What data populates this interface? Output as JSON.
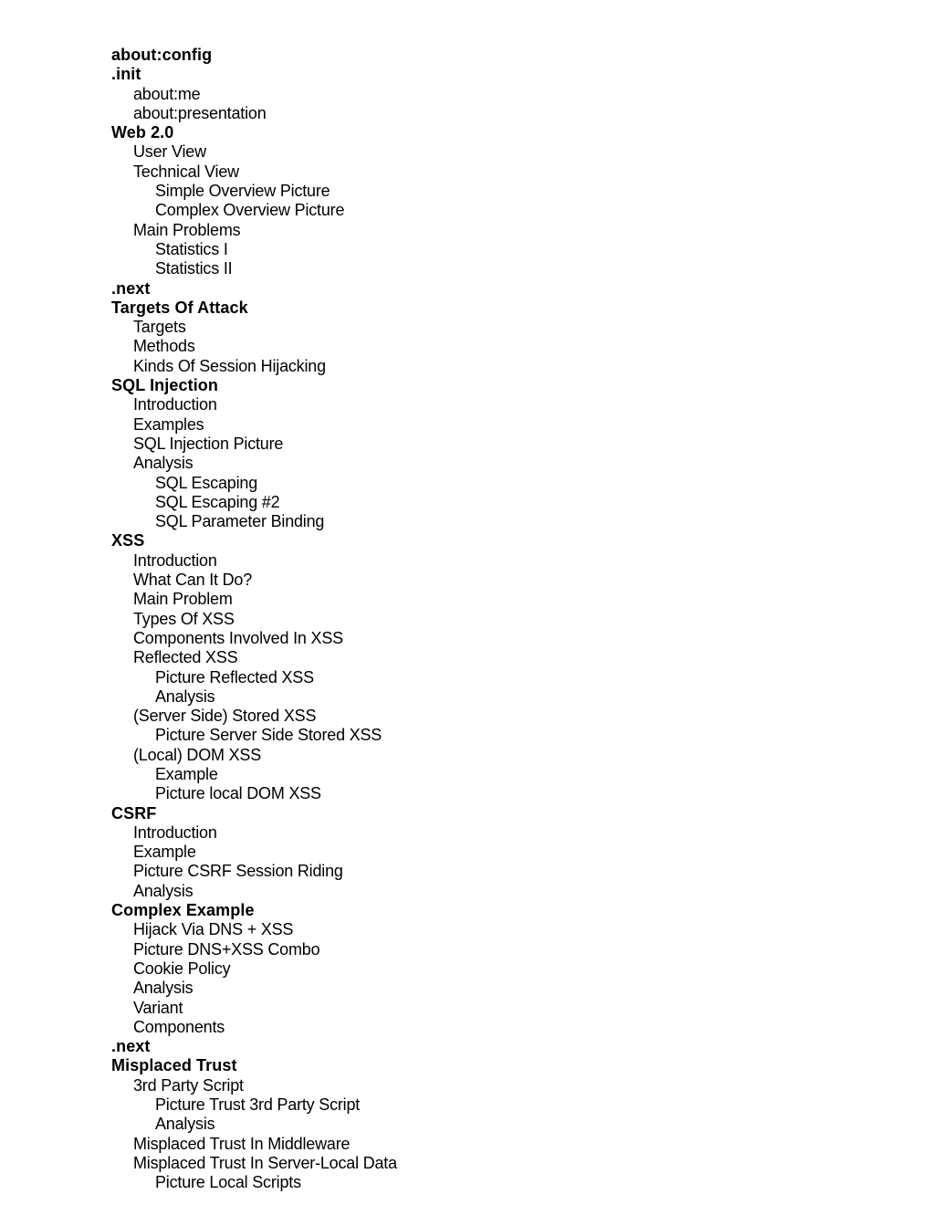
{
  "outline": [
    {
      "label": "about:config",
      "level": 0
    },
    {
      "label": ".init",
      "level": 0
    },
    {
      "label": "about:me",
      "level": 1
    },
    {
      "label": "about:presentation",
      "level": 1
    },
    {
      "label": "Web 2.0",
      "level": 0
    },
    {
      "label": "User View",
      "level": 1
    },
    {
      "label": "Technical View",
      "level": 1
    },
    {
      "label": "Simple Overview Picture",
      "level": 2
    },
    {
      "label": "Complex Overview Picture",
      "level": 2
    },
    {
      "label": "Main Problems",
      "level": 1
    },
    {
      "label": "Statistics I",
      "level": 2
    },
    {
      "label": "Statistics II",
      "level": 2
    },
    {
      "label": ".next",
      "level": 0
    },
    {
      "label": "Targets Of Attack",
      "level": 0
    },
    {
      "label": "Targets",
      "level": 1
    },
    {
      "label": "Methods",
      "level": 1
    },
    {
      "label": "Kinds Of Session Hijacking",
      "level": 1
    },
    {
      "label": "SQL Injection",
      "level": 0
    },
    {
      "label": "Introduction",
      "level": 1
    },
    {
      "label": "Examples",
      "level": 1
    },
    {
      "label": "SQL Injection Picture",
      "level": 1
    },
    {
      "label": "Analysis",
      "level": 1
    },
    {
      "label": "SQL Escaping",
      "level": 2
    },
    {
      "label": "SQL Escaping #2",
      "level": 2
    },
    {
      "label": "SQL Parameter Binding",
      "level": 2
    },
    {
      "label": "XSS",
      "level": 0
    },
    {
      "label": "Introduction",
      "level": 1
    },
    {
      "label": "What Can It Do?",
      "level": 1
    },
    {
      "label": "Main Problem",
      "level": 1
    },
    {
      "label": "Types Of XSS",
      "level": 1
    },
    {
      "label": "Components Involved In XSS",
      "level": 1
    },
    {
      "label": "Reflected XSS",
      "level": 1
    },
    {
      "label": "Picture Reflected XSS",
      "level": 2
    },
    {
      "label": "Analysis",
      "level": 2
    },
    {
      "label": "(Server Side) Stored XSS",
      "level": 1
    },
    {
      "label": "Picture Server Side Stored XSS",
      "level": 2
    },
    {
      "label": "(Local) DOM XSS",
      "level": 1
    },
    {
      "label": "Example",
      "level": 2
    },
    {
      "label": "Picture local DOM XSS",
      "level": 2
    },
    {
      "label": "CSRF",
      "level": 0
    },
    {
      "label": "Introduction",
      "level": 1
    },
    {
      "label": "Example",
      "level": 1
    },
    {
      "label": "Picture CSRF Session Riding",
      "level": 1
    },
    {
      "label": "Analysis",
      "level": 1
    },
    {
      "label": "Complex Example",
      "level": 0
    },
    {
      "label": "Hijack Via DNS + XSS",
      "level": 1
    },
    {
      "label": "Picture DNS+XSS Combo",
      "level": 1
    },
    {
      "label": "Cookie Policy",
      "level": 1
    },
    {
      "label": "Analysis",
      "level": 1
    },
    {
      "label": "Variant",
      "level": 1
    },
    {
      "label": "Components",
      "level": 1
    },
    {
      "label": ".next",
      "level": 0
    },
    {
      "label": "Misplaced Trust",
      "level": 0
    },
    {
      "label": "3rd Party Script",
      "level": 1
    },
    {
      "label": "Picture Trust 3rd Party Script",
      "level": 2
    },
    {
      "label": "Analysis",
      "level": 2
    },
    {
      "label": "Misplaced Trust In Middleware",
      "level": 1
    },
    {
      "label": "Misplaced Trust In Server-Local Data",
      "level": 1
    },
    {
      "label": "Picture Local Scripts",
      "level": 2
    }
  ]
}
